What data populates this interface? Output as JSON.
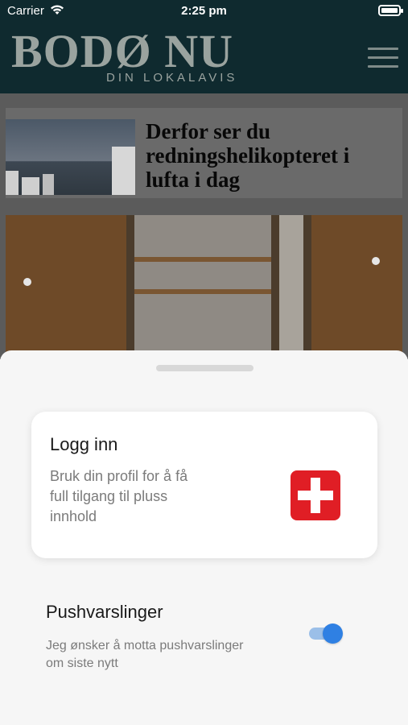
{
  "status_bar": {
    "carrier": "Carrier",
    "time": "2:25 pm"
  },
  "header": {
    "logo_title": "BODØ NU",
    "logo_subtitle": "DIN LOKALAVIS"
  },
  "feed": {
    "article_headline": "Derfor ser du redningshelikopteret i lufta i dag"
  },
  "sheet": {
    "login": {
      "title": "Logg inn",
      "description": "Bruk din profil for å få full tilgang til pluss innhold",
      "icon": "plus-icon",
      "icon_color": "#e01e25"
    },
    "push": {
      "title": "Pushvarslinger",
      "description": "Jeg ønsker å motta pushvarslinger om siste nytt",
      "toggle_on": true,
      "toggle_color": "#2f80e3"
    }
  }
}
